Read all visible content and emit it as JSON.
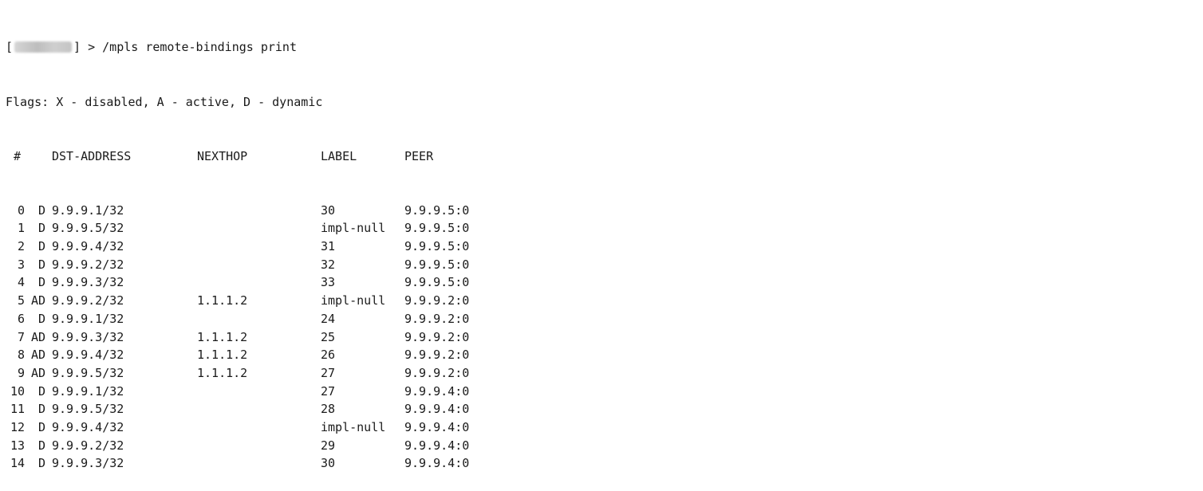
{
  "terminal": {
    "prompt_open": "[",
    "prompt_close": "] > ",
    "command": "/mpls remote-bindings print",
    "flags_line": "Flags: X - disabled, A - active, D - dynamic",
    "columns": {
      "num": "#",
      "dst": "DST-ADDRESS",
      "nexthop": "NEXTHOP",
      "label": "LABEL",
      "peer": "PEER"
    },
    "rows": [
      {
        "num": "0",
        "flags": "D",
        "dst": "9.9.9.1/32",
        "nexthop": "",
        "label": "30",
        "peer": "9.9.9.5:0"
      },
      {
        "num": "1",
        "flags": "D",
        "dst": "9.9.9.5/32",
        "nexthop": "",
        "label": "impl-null",
        "peer": "9.9.9.5:0"
      },
      {
        "num": "2",
        "flags": "D",
        "dst": "9.9.9.4/32",
        "nexthop": "",
        "label": "31",
        "peer": "9.9.9.5:0"
      },
      {
        "num": "3",
        "flags": "D",
        "dst": "9.9.9.2/32",
        "nexthop": "",
        "label": "32",
        "peer": "9.9.9.5:0"
      },
      {
        "num": "4",
        "flags": "D",
        "dst": "9.9.9.3/32",
        "nexthop": "",
        "label": "33",
        "peer": "9.9.9.5:0"
      },
      {
        "num": "5",
        "flags": "AD",
        "dst": "9.9.9.2/32",
        "nexthop": "1.1.1.2",
        "label": "impl-null",
        "peer": "9.9.9.2:0"
      },
      {
        "num": "6",
        "flags": "D",
        "dst": "9.9.9.1/32",
        "nexthop": "",
        "label": "24",
        "peer": "9.9.9.2:0"
      },
      {
        "num": "7",
        "flags": "AD",
        "dst": "9.9.9.3/32",
        "nexthop": "1.1.1.2",
        "label": "25",
        "peer": "9.9.9.2:0"
      },
      {
        "num": "8",
        "flags": "AD",
        "dst": "9.9.9.4/32",
        "nexthop": "1.1.1.2",
        "label": "26",
        "peer": "9.9.9.2:0"
      },
      {
        "num": "9",
        "flags": "AD",
        "dst": "9.9.9.5/32",
        "nexthop": "1.1.1.2",
        "label": "27",
        "peer": "9.9.9.2:0"
      },
      {
        "num": "10",
        "flags": "D",
        "dst": "9.9.9.1/32",
        "nexthop": "",
        "label": "27",
        "peer": "9.9.9.4:0"
      },
      {
        "num": "11",
        "flags": "D",
        "dst": "9.9.9.5/32",
        "nexthop": "",
        "label": "28",
        "peer": "9.9.9.4:0"
      },
      {
        "num": "12",
        "flags": "D",
        "dst": "9.9.9.4/32",
        "nexthop": "",
        "label": "impl-null",
        "peer": "9.9.9.4:0"
      },
      {
        "num": "13",
        "flags": "D",
        "dst": "9.9.9.2/32",
        "nexthop": "",
        "label": "29",
        "peer": "9.9.9.4:0"
      },
      {
        "num": "14",
        "flags": "D",
        "dst": "9.9.9.3/32",
        "nexthop": "",
        "label": "30",
        "peer": "9.9.9.4:0"
      }
    ]
  }
}
